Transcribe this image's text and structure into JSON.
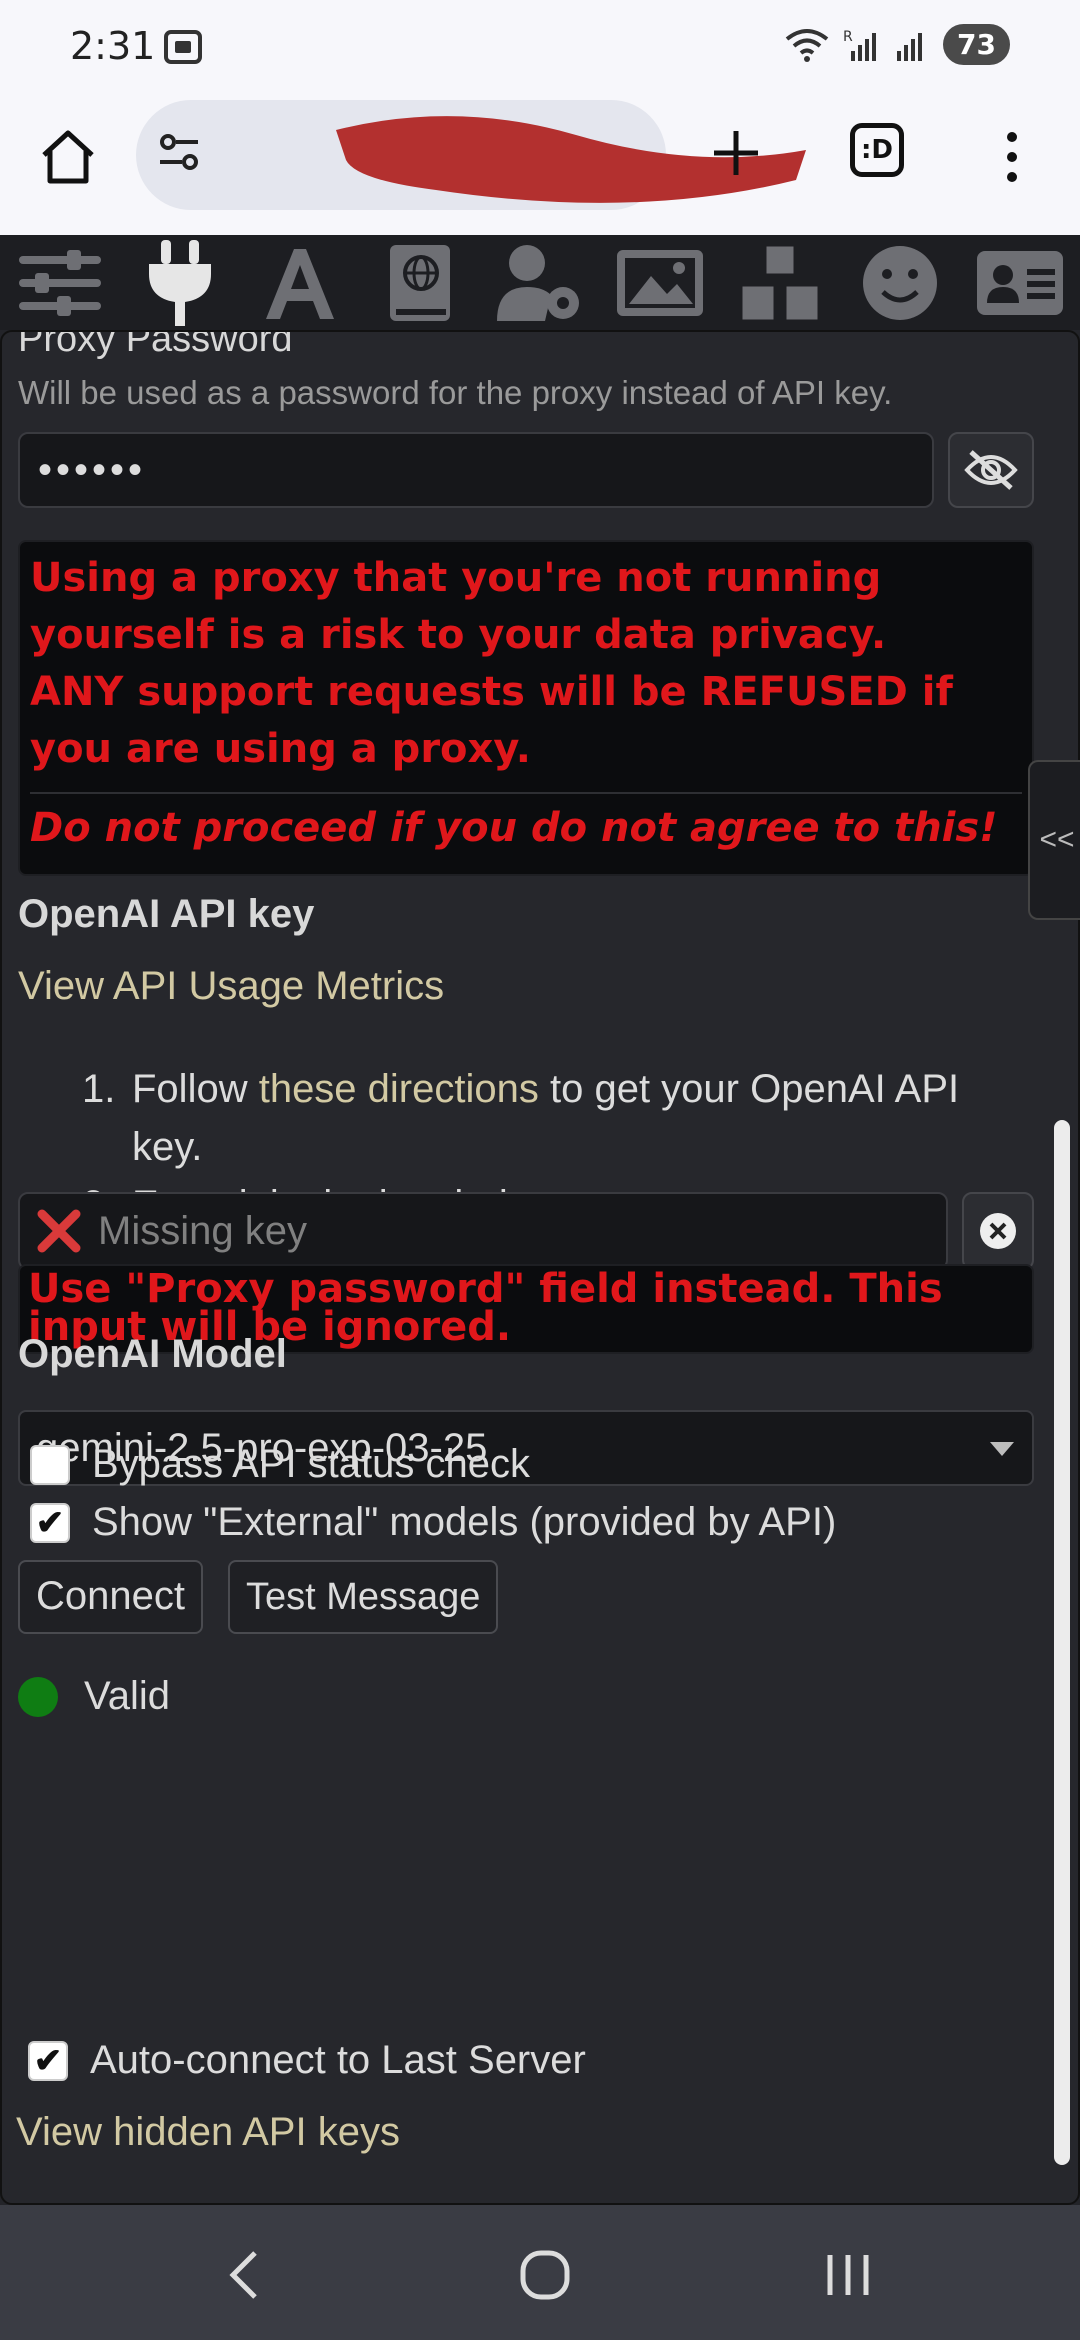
{
  "status_bar": {
    "time": "2:31",
    "battery": "73"
  },
  "browser": {
    "tabs_label": ":D"
  },
  "toolbar": {
    "icons": [
      "sliders-icon",
      "plug-icon",
      "font-icon",
      "book-globe-icon",
      "user-gear-icon",
      "image-icon",
      "cubes-icon",
      "smiley-icon",
      "id-card-icon"
    ]
  },
  "panel": {
    "proxy_password": {
      "title": "Proxy Password",
      "hint": "Will be used as a password for the proxy instead of API key.",
      "value": "••••••"
    },
    "proxy_warning": {
      "line1": "Using a proxy that you're not running yourself is a risk to your data privacy.",
      "line2": "ANY support requests will be REFUSED if you are using a proxy.",
      "italic": "Do not proceed if you do not agree to this!"
    },
    "side_tab_label": "<<",
    "api_key": {
      "title": "OpenAI API key",
      "usage_link": "View API Usage Metrics",
      "step1_prefix": "Follow ",
      "step1_link": "these directions",
      "step1_suffix": " to get your OpenAI API key.",
      "step2": "Enter it in the box below:",
      "placeholder": "Missing key",
      "ignored_warning": "Use \"Proxy password\" field instead. This input will be ignored."
    },
    "model": {
      "title": "OpenAI Model",
      "selected": "gemini-2.5-pro-exp-03-25"
    },
    "options": {
      "bypass_label": "Bypass API status check",
      "bypass_checked": false,
      "external_label": "Show \"External\" models (provided by API)",
      "external_checked": true,
      "autoconnect_label": "Auto-connect to Last Server",
      "autoconnect_checked": true
    },
    "buttons": {
      "connect": "Connect",
      "test_message": "Test Message"
    },
    "status": {
      "label": "Valid",
      "color": "#0f7d13"
    },
    "hidden_keys_link": "View hidden API keys"
  },
  "colors": {
    "warning_red": "#e0171b",
    "link": "#d2c9a3",
    "panel_bg": "#26272c"
  }
}
